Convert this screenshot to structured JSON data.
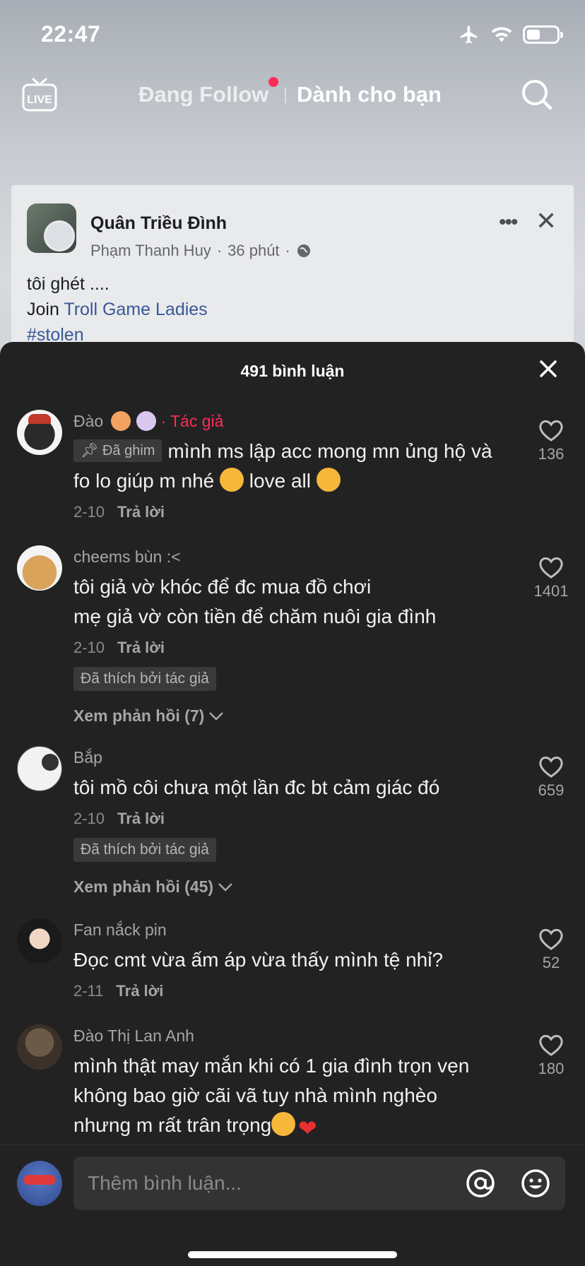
{
  "status_bar": {
    "time": "22:47"
  },
  "top_nav": {
    "live_label": "LIVE",
    "following_tab": "Đang Follow",
    "for_you_tab": "Dành cho bạn"
  },
  "video_card": {
    "name": "Quân Triều Đình",
    "author": "Phạm Thanh Huy",
    "time": "36 phút",
    "line1": "tôi ghét ....",
    "join_prefix": "Join ",
    "join_link": "Troll Game Ladies",
    "hashtag": "#stolen"
  },
  "comments_sheet": {
    "title": "491 bình luận",
    "reply_label": "Trả lời",
    "liked_by_author": "Đã thích bởi tác giả",
    "pinned_label": "Đã ghim",
    "comments": [
      {
        "name": "Đào",
        "author_tag": "· Tác giả",
        "text_part1": "mình ms lập acc mong mn ủng hộ và fo lo giúp m nhé ",
        "text_part2": " love all ",
        "date": "2-10",
        "likes": "136"
      },
      {
        "name": "cheems bùn :<",
        "text_line1": "tôi giả vờ khóc để đc mua đồ chơi",
        "text_line2": "mẹ giả vờ còn tiền để chăm nuôi gia đình",
        "date": "2-10",
        "likes": "1401",
        "view_replies": "Xem phản hồi (7)"
      },
      {
        "name": "Bắp",
        "text": "tôi mồ côi chưa một lần đc bt cảm giác đó",
        "date": "2-10",
        "likes": "659",
        "view_replies": "Xem phản hồi (45)"
      },
      {
        "name": "Fan nắck pin",
        "text": "Đọc cmt vừa ấm áp vừa thấy mình tệ nhỉ?",
        "date": "2-11",
        "likes": "52"
      },
      {
        "name": "Đào Thị Lan Anh",
        "text": "mình thật may mắn khi có 1 gia đình trọn vẹn không bao giờ cãi vã tuy nhà mình nghèo nhưng m rất trân trọng",
        "likes": "180"
      }
    ]
  },
  "input_bar": {
    "placeholder": "Thêm bình luận..."
  },
  "colors": {
    "sheet_bg": "#222223",
    "author_tag": "#fe2c55",
    "live_dot": "#fe2c55"
  }
}
